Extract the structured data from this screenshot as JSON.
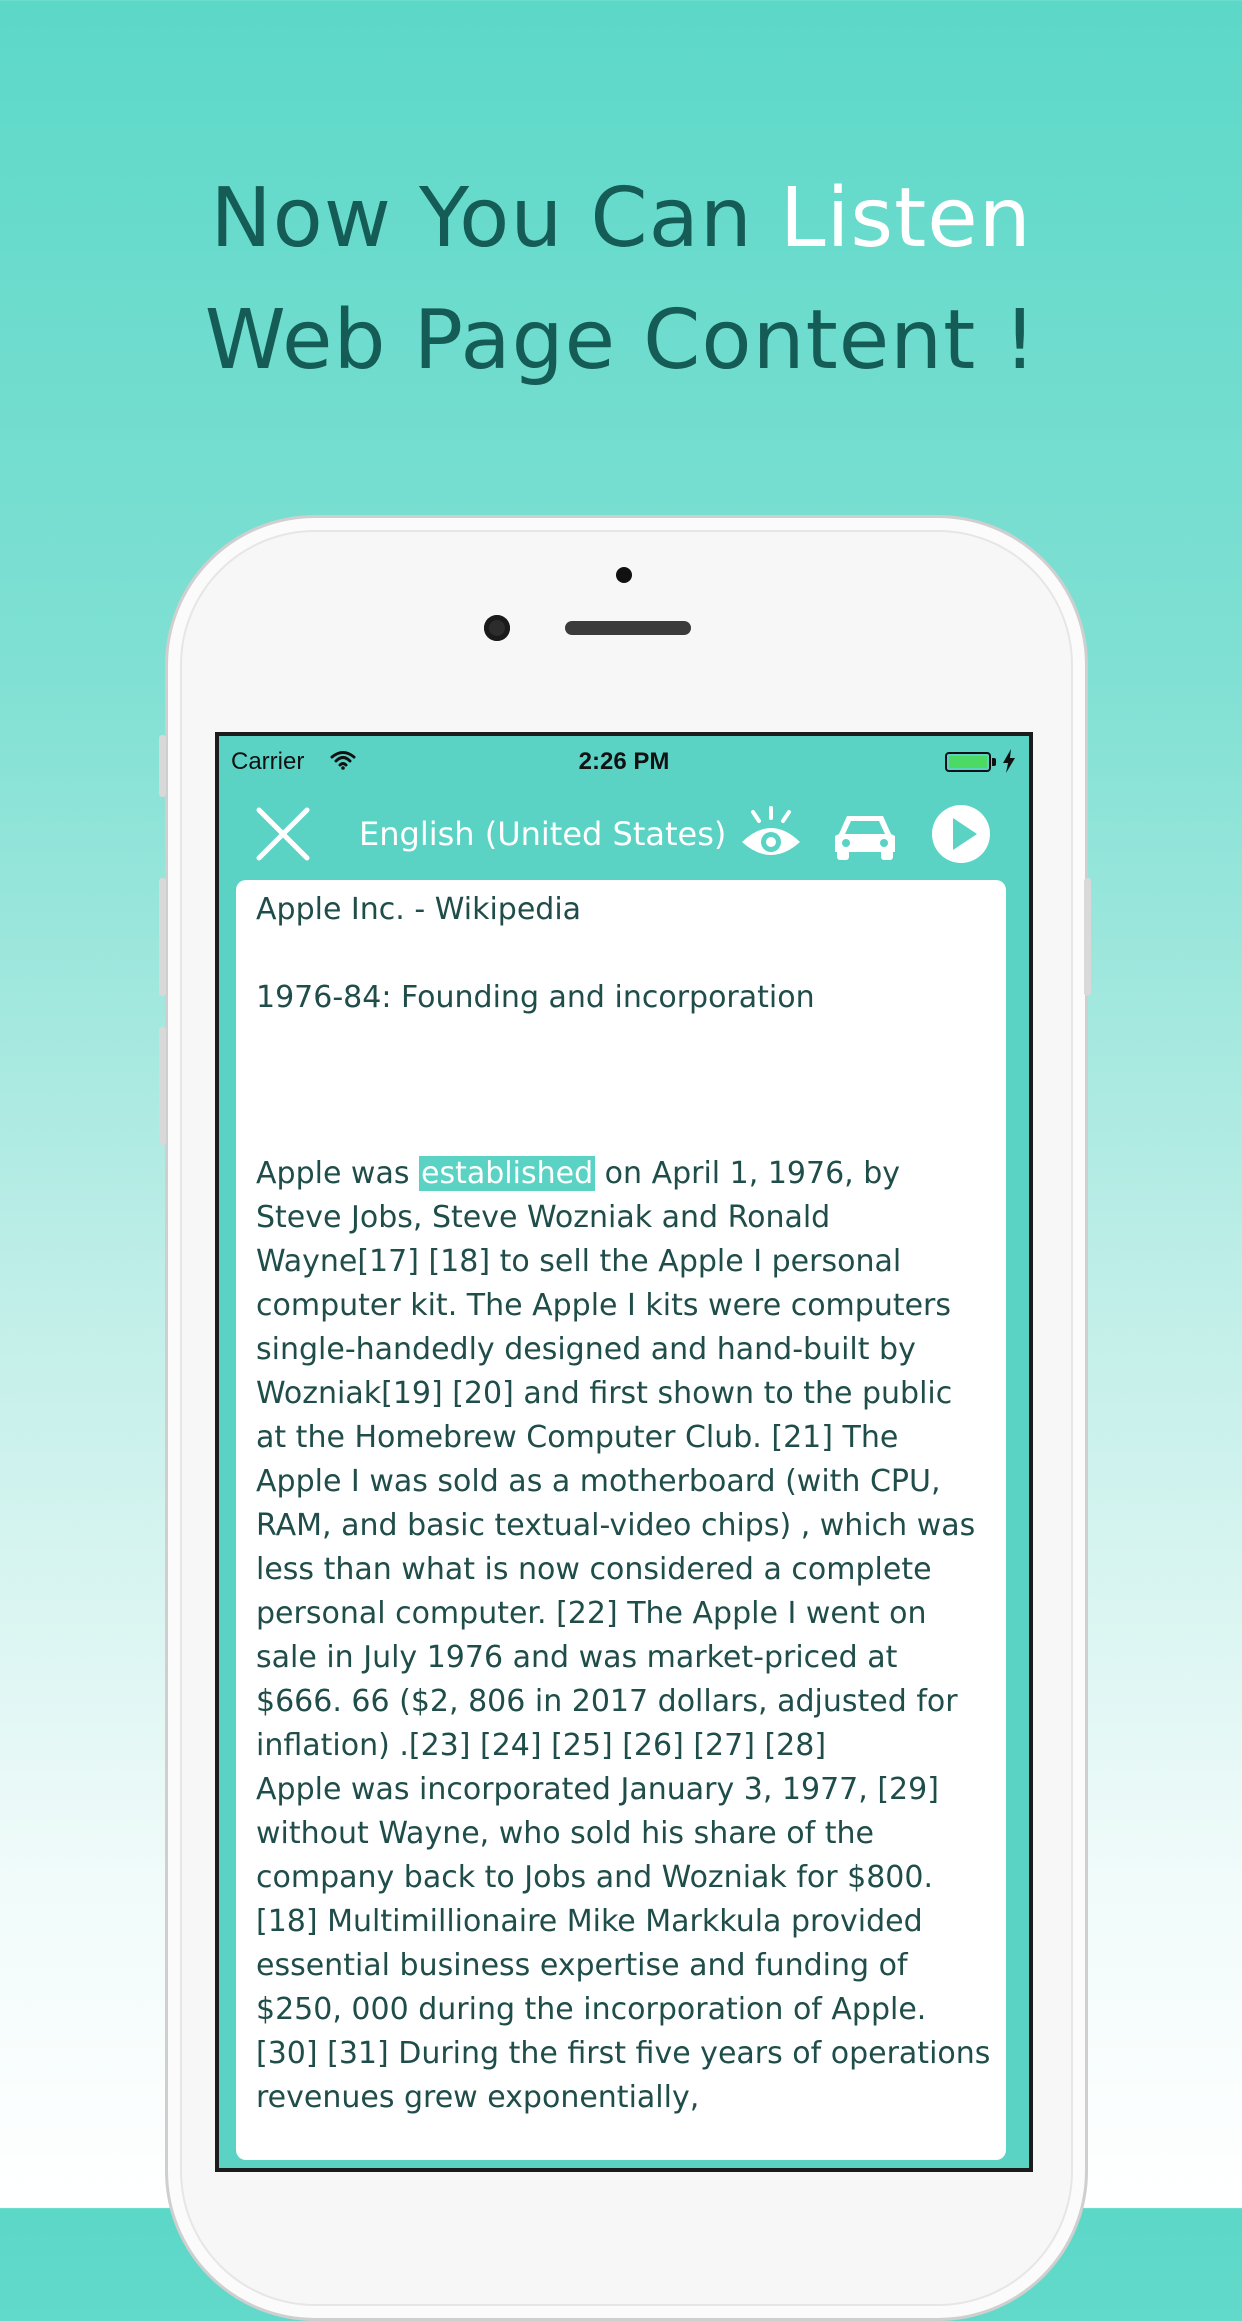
{
  "headline": {
    "line1_prefix": "Now You Can ",
    "line1_accent": "Listen",
    "line2": "Web Page Content !"
  },
  "status_bar": {
    "carrier": "Carrier",
    "time": "2:26 PM",
    "wifi_icon": "wifi-icon",
    "battery_icon": "battery-charging-icon"
  },
  "toolbar": {
    "close_icon": "close-icon",
    "language": "English (United States)",
    "eye_icon": "eye-icon",
    "car_icon": "car-icon",
    "play_icon": "play-icon"
  },
  "content": {
    "page_title": "Apple Inc. - Wikipedia",
    "section_heading": "1976-84: Founding and incorporation",
    "paragraph1_before": "Apple was ",
    "paragraph1_highlight": "established",
    "paragraph1_after": " on April 1, 1976, by Steve Jobs, Steve Wozniak and Ronald Wayne[17] [18] to sell the Apple I personal computer kit. The Apple I kits were computers single-handedly designed and hand-built by Wozniak[19] [20] and first shown to the public at the Homebrew Computer Club. [21] The Apple I was sold as a motherboard (with CPU, RAM, and basic textual-video chips) , which was less than what is now considered a complete personal computer. [22] The Apple I went on sale in July 1976 and was market-priced at $666. 66 ($2, 806 in 2017 dollars, adjusted for inflation) .[23] [24] [25] [26] [27] [28]",
    "paragraph2": "Apple was incorporated January 3, 1977, [29] without Wayne, who sold his share of the company back to Jobs and Wozniak for $800. [18] Multimillionaire Mike Markkula provided essential business expertise and funding of $250, 000 during the incorporation of Apple. [30] [31] During the first five years of operations revenues grew exponentially,"
  },
  "colors": {
    "accent": "#5ad3c5",
    "headline_text": "#155c57",
    "body_text": "#1f4d49",
    "battery": "#4cd964"
  }
}
